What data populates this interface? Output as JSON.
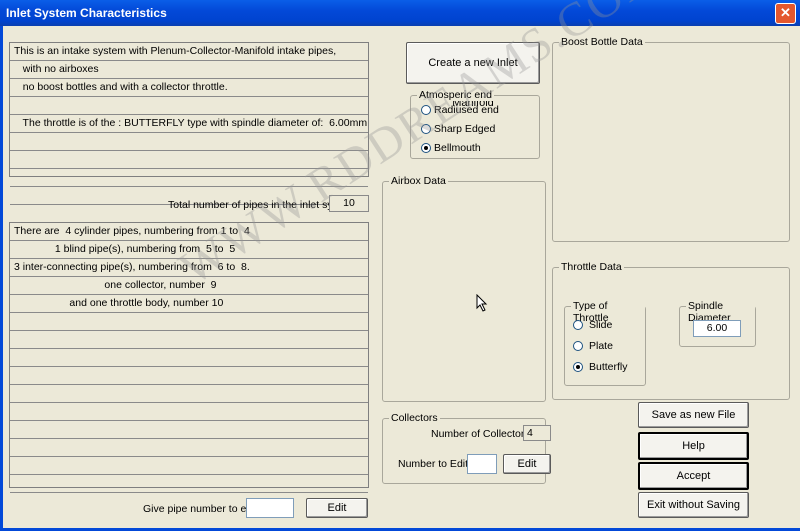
{
  "window": {
    "title": "Inlet System Characteristics",
    "close_icon": "close-icon"
  },
  "description_lines": [
    "This is an intake system with Plenum-Collector-Manifold intake pipes,",
    "   with no airboxes",
    "   no boost bottles and with a collector throttle.",
    "",
    "   The throttle is of the : BUTTERFLY type with spindle diameter of:  6.00mm",
    "",
    "",
    "",
    ""
  ],
  "total_pipes": {
    "label": "Total number of pipes in the inlet system :",
    "value": "10"
  },
  "pipe_lines": [
    "There are  4 cylinder pipes, numbering from 1 to  4",
    "              1 blind pipe(s), numbering from  5 to  5",
    "3 inter-connecting pipe(s), numbering from  6 to  8.",
    "                               one collector, number  9",
    "                   and one throttle body, number 10",
    "",
    "",
    "",
    "",
    "",
    "",
    "",
    "",
    "",
    ""
  ],
  "edit_pipe": {
    "label": "Give pipe number to edit:",
    "value": "",
    "button": "Edit"
  },
  "create_manifold_button": "Create a new Inlet Manifold",
  "atmospheric_end": {
    "legend": "Atmosperic end",
    "options": [
      "Radiused end",
      "Sharp Edged",
      "Bellmouth"
    ],
    "selected": "Bellmouth"
  },
  "airbox": {
    "legend": "Airbox Data"
  },
  "boost_bottle": {
    "legend": "Boost Bottle Data"
  },
  "throttle": {
    "legend": "Throttle Data",
    "type_legend": "Type of Throttle",
    "types": [
      "Slide",
      "Plate",
      "Butterfly"
    ],
    "selected": "Butterfly",
    "spindle_legend": "Spindle Diameter",
    "spindle_value": "6.00"
  },
  "collectors": {
    "legend": "Collectors",
    "count_label": "Number of Collectors:",
    "count_value": "4",
    "edit_label": "Number to Edit:",
    "edit_value": "",
    "edit_button": "Edit"
  },
  "buttons": {
    "save_new": "Save as new File",
    "help": "Help",
    "accept": "Accept",
    "exit": "Exit without Saving"
  },
  "watermark": "WWW.RDDREAMS.COM"
}
